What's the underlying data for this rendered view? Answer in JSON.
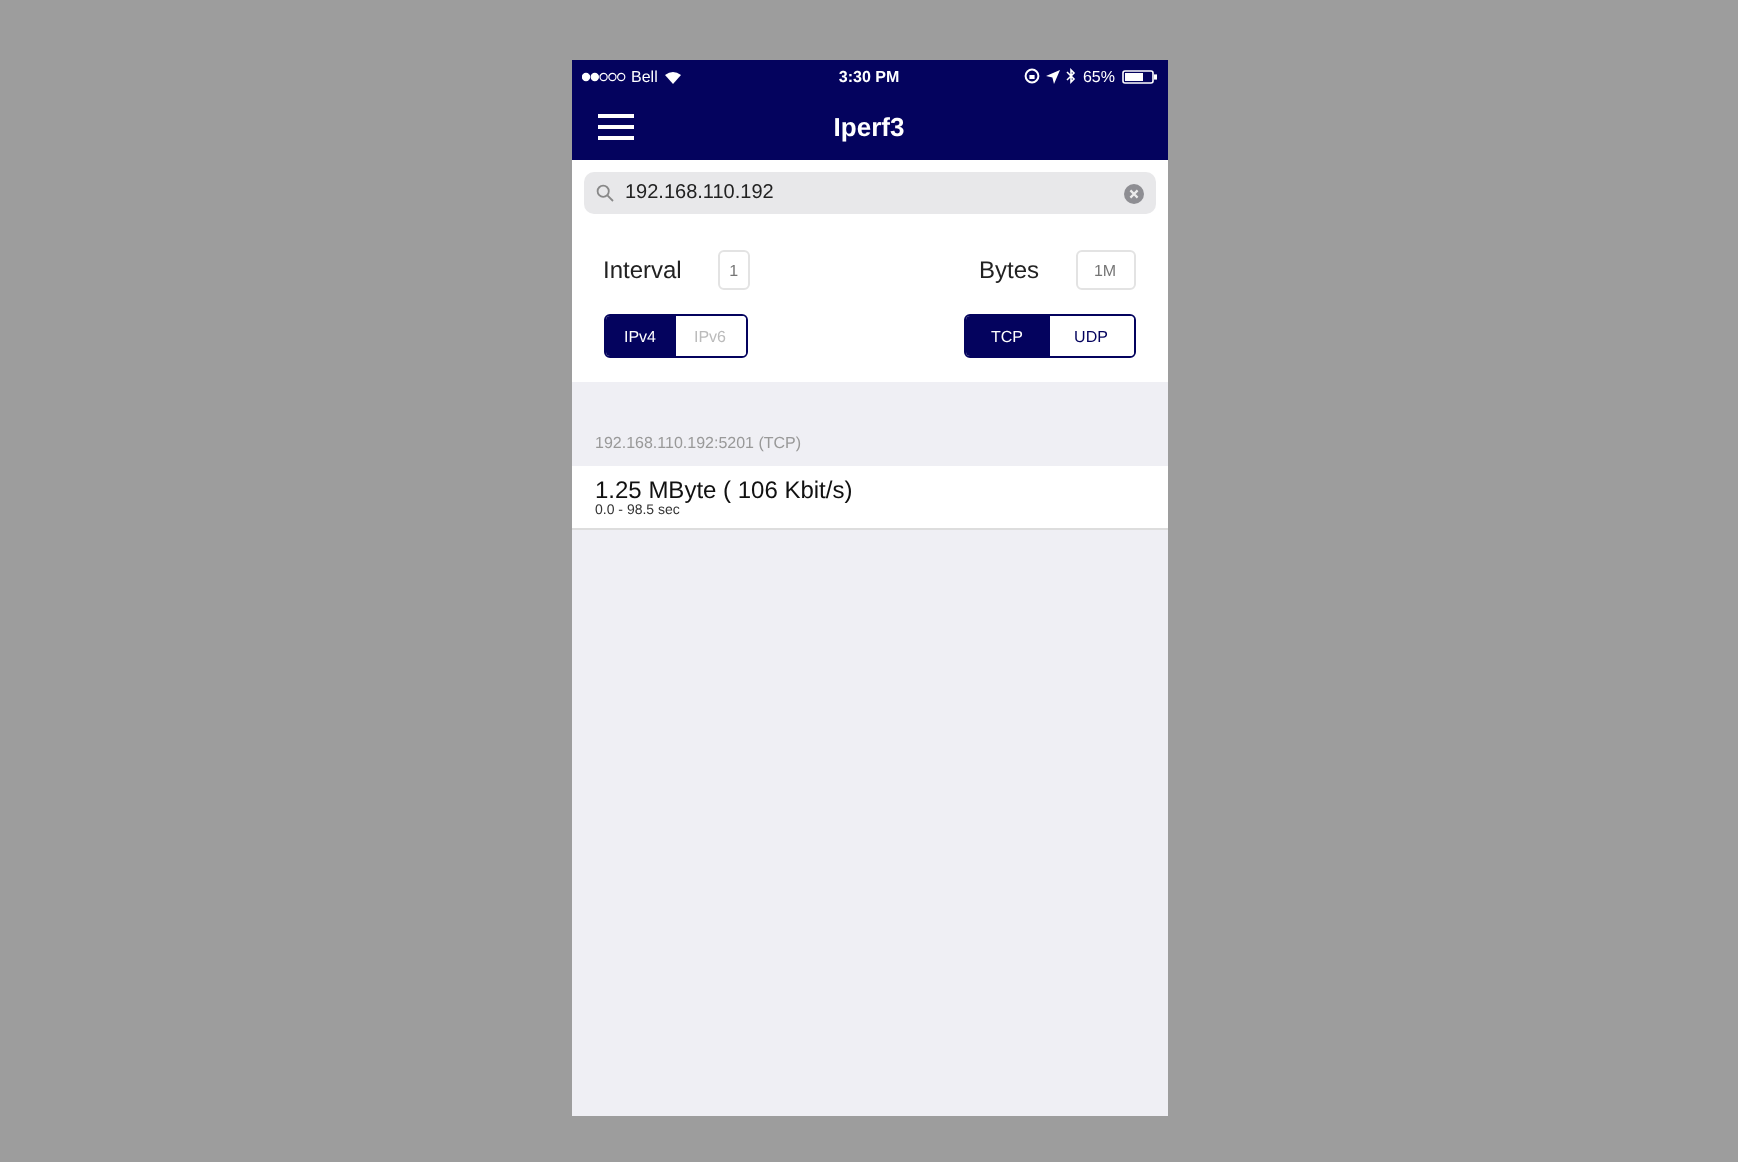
{
  "status_bar": {
    "carrier": "Bell",
    "time": "3:30 PM",
    "battery": "65%"
  },
  "nav": {
    "title": "Iperf3"
  },
  "search": {
    "value": "192.168.110.192"
  },
  "settings": {
    "interval": {
      "label": "Interval",
      "placeholder": "1"
    },
    "bytes": {
      "label": "Bytes",
      "placeholder": "1M"
    },
    "ip_version": [
      {
        "label": "IPv4",
        "selected": true,
        "disabled": false
      },
      {
        "label": "IPv6",
        "selected": false,
        "disabled": true
      }
    ],
    "protocol": [
      {
        "label": "TCP",
        "selected": true,
        "disabled": false
      },
      {
        "label": "UDP",
        "selected": false,
        "disabled": false
      }
    ]
  },
  "results": {
    "header": "192.168.110.192:5201 (TCP)",
    "rows": [
      {
        "title": "1.25 MByte ( 106 Kbit/s)",
        "subtitle": "0.0 - 98.5 sec"
      }
    ]
  }
}
